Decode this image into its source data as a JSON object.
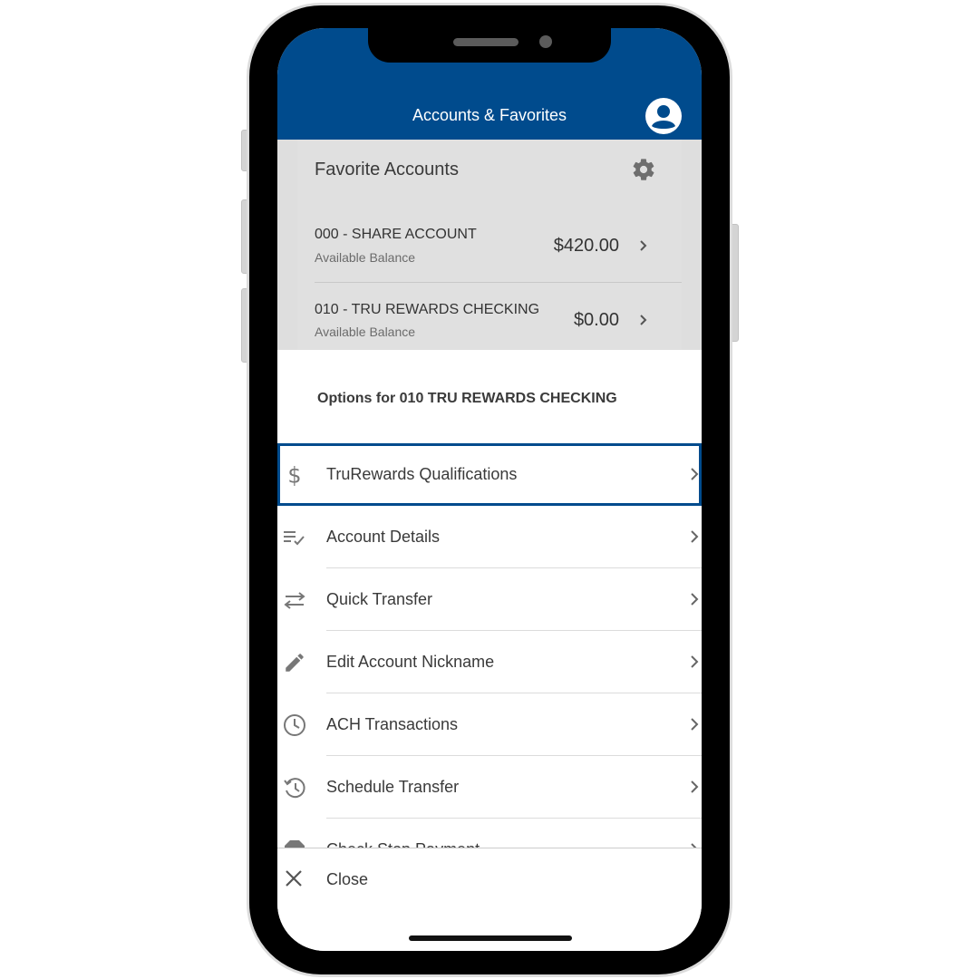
{
  "header": {
    "title": "Accounts & Favorites"
  },
  "favorites": {
    "title": "Favorite Accounts",
    "accounts": [
      {
        "name": "000 - SHARE ACCOUNT",
        "subtitle": "Available Balance",
        "balance": "$420.00"
      },
      {
        "name": "010 - TRU REWARDS CHECKING",
        "subtitle": "Available Balance",
        "balance": "$0.00"
      }
    ]
  },
  "sheet": {
    "title": "Options for 010 TRU REWARDS CHECKING",
    "options": [
      {
        "label": "TruRewards Qualifications",
        "icon": "dollar-icon",
        "selected": true
      },
      {
        "label": "Account Details",
        "icon": "list-check-icon"
      },
      {
        "label": "Quick Transfer",
        "icon": "swap-arrows-icon"
      },
      {
        "label": "Edit Account Nickname",
        "icon": "pencil-icon"
      },
      {
        "label": "ACH Transactions",
        "icon": "clock-icon"
      },
      {
        "label": "Schedule Transfer",
        "icon": "history-clock-icon"
      },
      {
        "label": "Check Stop Payment",
        "icon": "stop-icon"
      }
    ],
    "close_label": "Close"
  },
  "colors": {
    "brand_blue": "#004b8d",
    "dim_background": "#dedede",
    "icon_gray": "#7a7a7a"
  }
}
